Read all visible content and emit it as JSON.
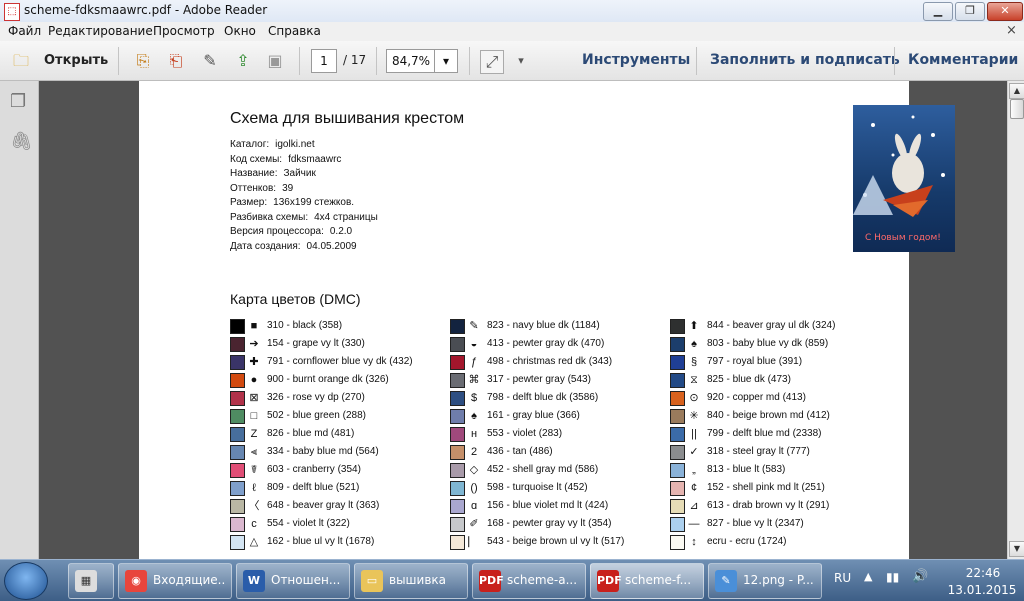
{
  "window": {
    "title": "scheme-fdksmaawrc.pdf - Adobe Reader",
    "icon": "pdf-app-icon",
    "controls": [
      "minimize-icon",
      "restore-icon",
      "close-icon"
    ]
  },
  "menu": [
    "Файл",
    "Редактирование",
    "Просмотр",
    "Окно",
    "Справка"
  ],
  "toolbar": {
    "open_label": "Открыть",
    "page_current": "1",
    "page_total": "/ 17",
    "zoom": "84,7%",
    "tools": "Инструменты",
    "fill_sign": "Заполнить и подписать",
    "comments": "Комментарии"
  },
  "page": {
    "title": "Схема для вышивания крестом",
    "meta": [
      {
        "k": "Каталог:",
        "v": "igolki.net"
      },
      {
        "k": "Код схемы:",
        "v": "fdksmaawrc"
      },
      {
        "k": "Название:",
        "v": "Зайчик"
      },
      {
        "k": "Оттенков:",
        "v": "39"
      },
      {
        "k": "Размер:",
        "v": "136x199 стежков."
      },
      {
        "k": "Разбивка схемы:",
        "v": "4x4 страницы"
      },
      {
        "k": "Версия процессора:",
        "v": "0.2.0"
      },
      {
        "k": "Дата создания:",
        "v": "04.05.2009"
      }
    ],
    "colors_title": "Карта цветов (DMC)",
    "col1": [
      {
        "c": "#000000",
        "s": "■",
        "t": "310 - black (358)"
      },
      {
        "c": "#4a2430",
        "s": "➔",
        "t": "154 - grape vy lt (330)"
      },
      {
        "c": "#3a3468",
        "s": "✚",
        "t": "791 - cornflower blue vy dk (432)"
      },
      {
        "c": "#d24a10",
        "s": "●",
        "t": "900 - burnt orange dk (326)"
      },
      {
        "c": "#b1324a",
        "s": "⊠",
        "t": "326 - rose vy dp (270)"
      },
      {
        "c": "#4f8c62",
        "s": "□",
        "t": "502 - blue green (288)"
      },
      {
        "c": "#476e9c",
        "s": "Z",
        "t": "826 - blue md (481)"
      },
      {
        "c": "#6787b1",
        "s": "⫷",
        "t": "334 - baby blue md (564)"
      },
      {
        "c": "#e04e76",
        "s": "☤",
        "t": "603 - cranberry (354)"
      },
      {
        "c": "#7f9fcb",
        "s": "ℓ",
        "t": "809 - delft blue (521)"
      },
      {
        "c": "#b9b7a4",
        "s": "〈",
        "t": "648 - beaver gray lt (363)"
      },
      {
        "c": "#dab8cf",
        "s": "c",
        "t": "554 - violet lt (322)"
      },
      {
        "c": "#d4e5f3",
        "s": "△",
        "t": "162 - blue ul vy lt (1678)"
      }
    ],
    "col2": [
      {
        "c": "#13233f",
        "s": "✎",
        "t": "823 - navy blue dk (1184)"
      },
      {
        "c": "#4a4d53",
        "s": "◒",
        "t": "413 - pewter gray dk (470)"
      },
      {
        "c": "#a3162c",
        "s": "ƒ",
        "t": "498 - christmas red dk (343)"
      },
      {
        "c": "#6a6c73",
        "s": "⌘",
        "t": "317 - pewter gray (543)"
      },
      {
        "c": "#2e4f82",
        "s": "$",
        "t": "798 - delft blue dk (3586)"
      },
      {
        "c": "#6f7dab",
        "s": "♠",
        "t": "161 - gray blue (366)"
      },
      {
        "c": "#a0497c",
        "s": "н",
        "t": "553 - violet (283)"
      },
      {
        "c": "#c6906a",
        "s": "2",
        "t": "436 - tan (486)"
      },
      {
        "c": "#a89aa9",
        "s": "◇",
        "t": "452 - shell gray md (586)"
      },
      {
        "c": "#7fb6d2",
        "s": "()",
        "t": "598 - turquoise lt (452)"
      },
      {
        "c": "#a9a7cf",
        "s": "ɑ",
        "t": "156 - blue violet md lt (424)"
      },
      {
        "c": "#c6c8cb",
        "s": "✐",
        "t": "168 - pewter gray vy lt (354)"
      },
      {
        "c": "#f4e8d8",
        "s": "⎸",
        "t": "543 - beige brown ul vy lt (517)"
      }
    ],
    "col3": [
      {
        "c": "#2e3030",
        "s": "⬆",
        "t": "844 - beaver gray ul dk (324)"
      },
      {
        "c": "#1c3e6c",
        "s": "♠",
        "t": "803 - baby blue vy dk (859)"
      },
      {
        "c": "#1f3f96",
        "s": "§",
        "t": "797 - royal blue (391)"
      },
      {
        "c": "#234a86",
        "s": "⧖",
        "t": "825 - blue dk (473)"
      },
      {
        "c": "#d8621e",
        "s": "⊙",
        "t": "920 - copper md (413)"
      },
      {
        "c": "#9a7b5c",
        "s": "✳",
        "t": "840 - beige brown md (412)"
      },
      {
        "c": "#3b6ba8",
        "s": "||",
        "t": "799 - delft blue md (2338)"
      },
      {
        "c": "#8b8d8f",
        "s": "✓",
        "t": "318 - steel gray lt (777)"
      },
      {
        "c": "#8ab2d8",
        "s": "„",
        "t": "813 - blue lt (583)"
      },
      {
        "c": "#e5b4b0",
        "s": "¢",
        "t": "152 - shell pink md lt (251)"
      },
      {
        "c": "#e6dcb6",
        "s": "⊿",
        "t": "613 - drab brown vy lt (291)"
      },
      {
        "c": "#acd0ee",
        "s": "—",
        "t": "827 - blue vy lt (2347)"
      },
      {
        "c": "#fbfaf3",
        "s": "↕",
        "t": "ecru - ecru (1724)"
      }
    ]
  },
  "taskbar": {
    "items": [
      {
        "label": "Входящие...",
        "icon": "chrome-icon",
        "bg": "#e8453c"
      },
      {
        "label": "Отношен...",
        "icon": "word-icon",
        "bg": "#2a5daa"
      },
      {
        "label": "вышивка",
        "icon": "folder-icon",
        "bg": "#e9c45a"
      },
      {
        "label": "scheme-a...",
        "icon": "pdf-icon",
        "bg": "#c8201c"
      },
      {
        "label": "scheme-f...",
        "icon": "pdf-icon",
        "bg": "#c8201c"
      },
      {
        "label": "12.png - P...",
        "icon": "paint-icon",
        "bg": "#4a8fd8"
      }
    ],
    "lang": "RU",
    "time": "22:46",
    "date": "13.01.2015"
  }
}
